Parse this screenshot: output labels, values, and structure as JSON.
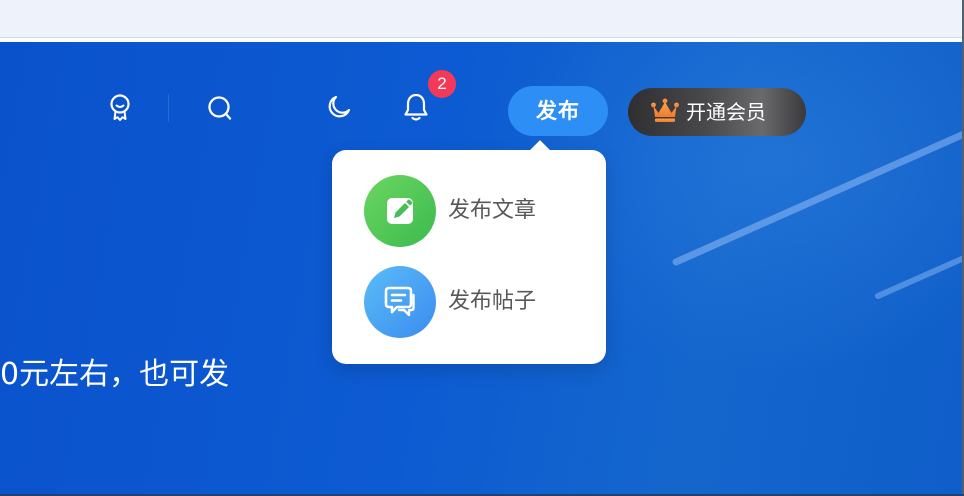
{
  "header": {
    "award_icon": "award-icon",
    "search_icon": "search-icon",
    "theme_icon": "moon-icon",
    "notifications": {
      "icon": "bell-icon",
      "count": "2"
    },
    "publish_label": "发布",
    "vip": {
      "icon": "crown-icon",
      "label": "开通会员"
    }
  },
  "publish_menu": {
    "items": [
      {
        "label": "发布文章",
        "icon": "edit-note-icon",
        "color_from": "#6bd660",
        "color_to": "#3cba4f"
      },
      {
        "label": "发布帖子",
        "icon": "chat-bubbles-icon",
        "color_from": "#5bbcf8",
        "color_to": "#3a8cef"
      }
    ]
  },
  "banner": {
    "text": "0元左右，也可发"
  },
  "colors": {
    "background": "#0c5ad0",
    "publish_button": "#2d8ef5",
    "badge": "#f3395a",
    "crown": "#f5873a",
    "menu_label": "#585858"
  }
}
